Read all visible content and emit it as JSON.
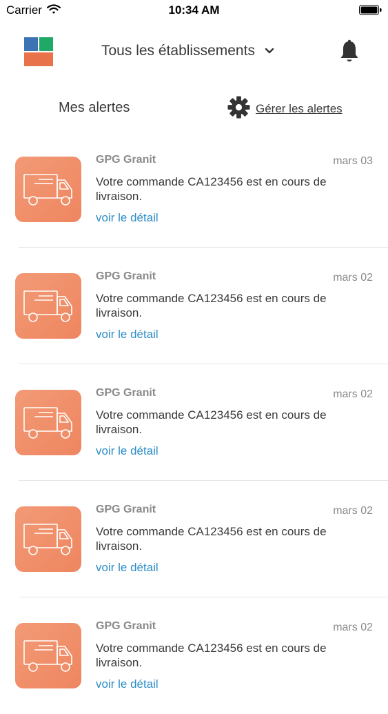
{
  "status_bar": {
    "carrier": "Carrier",
    "time": "10:34 AM"
  },
  "header": {
    "establishment_label": "Tous les établissements"
  },
  "alerts_bar": {
    "title": "Mes alertes",
    "manage_label": "Gérer les alertes"
  },
  "alerts": [
    {
      "company": "GPG Granit",
      "date": "mars 03",
      "message": "Votre commande CA123456 est en cours de livraison.",
      "detail_label": "voir le détail"
    },
    {
      "company": "GPG Granit",
      "date": "mars 02",
      "message": "Votre commande CA123456 est en cours de livraison.",
      "detail_label": "voir le détail"
    },
    {
      "company": "GPG Granit",
      "date": "mars 02",
      "message": "Votre commande CA123456 est en cours de livraison.",
      "detail_label": "voir le détail"
    },
    {
      "company": "GPG Granit",
      "date": "mars 02",
      "message": "Votre commande CA123456 est en cours de livraison.",
      "detail_label": "voir le détail"
    },
    {
      "company": "GPG Granit",
      "date": "mars 02",
      "message": "Votre commande CA123456 est en cours de livraison.",
      "detail_label": "voir le détail"
    }
  ],
  "icons": {
    "logo": "app-logo",
    "chevron": "chevron-down-icon",
    "bell": "bell-icon",
    "gear": "gear-icon",
    "truck": "truck-icon"
  },
  "colors": {
    "accent_link": "#2a8dc6",
    "thumb_orange": "#f08f68",
    "logo_blue": "#3d72b4",
    "logo_green": "#20a866",
    "logo_orange": "#e8734a"
  }
}
